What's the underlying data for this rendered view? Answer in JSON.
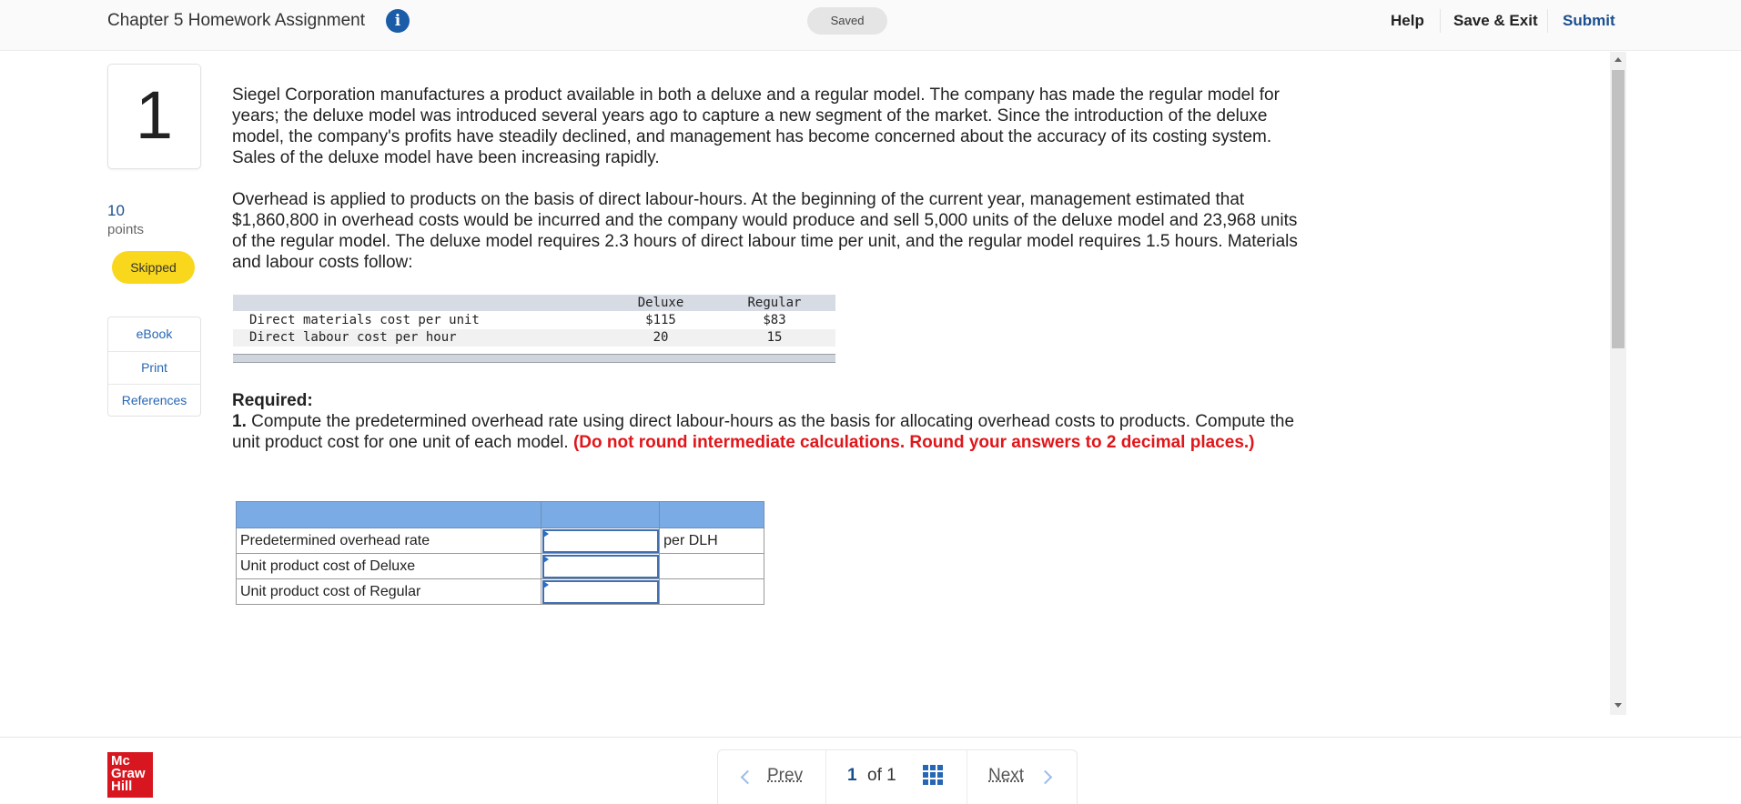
{
  "header": {
    "title": "Chapter 5 Homework Assignment",
    "status": "Saved",
    "help_label": "Help",
    "save_exit_label": "Save & Exit",
    "submit_label": "Submit"
  },
  "question": {
    "number": "1",
    "points_value": "10",
    "points_label": "points",
    "status_badge": "Skipped"
  },
  "tools": {
    "ebook": "eBook",
    "print": "Print",
    "references": "References"
  },
  "problem": {
    "paragraph1": "Siegel Corporation manufactures a product available in both a deluxe and a regular model. The company has made the regular model for years; the deluxe model was introduced several years ago to capture a new segment of the market. Since the introduction of the deluxe model, the company's profits have steadily declined, and management has become concerned about the accuracy of its costing system. Sales of the deluxe model have been increasing rapidly.",
    "paragraph2": "Overhead is applied to products on the basis of direct labour-hours. At the beginning of the current year, management estimated that $1,860,800 in overhead costs would be incurred and the company would produce and sell 5,000 units of the deluxe model and 23,968 units of the regular model. The deluxe model requires 2.3 hours of direct labour time per unit, and the regular model requires 1.5 hours. Materials and labour costs follow:"
  },
  "cost_table": {
    "columns": [
      "Deluxe",
      "Regular"
    ],
    "rows": [
      {
        "label": "Direct materials cost per unit",
        "deluxe": "$115",
        "regular": "$83"
      },
      {
        "label": "Direct labour cost per hour",
        "deluxe": "20",
        "regular": "15"
      }
    ]
  },
  "required": {
    "heading": "Required:",
    "item_number": "1.",
    "item_text": "Compute the predetermined overhead rate using direct labour-hours as the basis for allocating overhead costs to products. Compute the unit product cost for one unit of each model.",
    "instruction": "(Do not round intermediate calculations. Round your answers to 2 decimal places.)"
  },
  "answer_table": {
    "rows": [
      {
        "label": "Predetermined overhead rate",
        "value": "",
        "unit": "per DLH"
      },
      {
        "label": "Unit product cost of Deluxe",
        "value": "",
        "unit": ""
      },
      {
        "label": "Unit product cost of Regular",
        "value": "",
        "unit": ""
      }
    ]
  },
  "footer": {
    "logo_lines": [
      "Mc",
      "Graw",
      "Hill"
    ],
    "prev_label": "Prev",
    "page_current": "1",
    "page_of": "of 1",
    "next_label": "Next"
  },
  "colors": {
    "accent_blue": "#1a4f8f",
    "link_blue": "#2766b5",
    "badge_yellow": "#f9d71c",
    "table_header_blue": "#7aabe4",
    "instruction_red": "#e0161a",
    "logo_red": "#d7161f"
  },
  "icons": {
    "info": "info-icon",
    "prev": "chevron-left-icon",
    "next": "chevron-right-icon",
    "question_map": "grid-icon"
  }
}
